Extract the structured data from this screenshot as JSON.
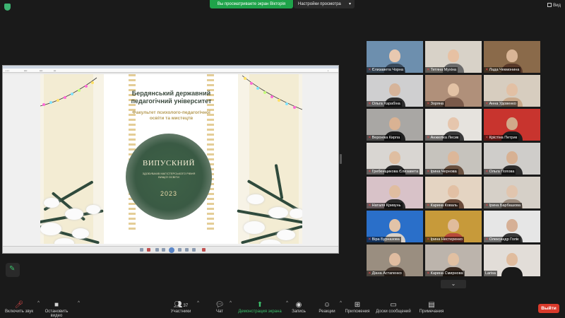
{
  "top_bar": {
    "share_notice": "Вы просматриваете экран Вікторія",
    "view_settings": "Настройки просмотра",
    "view_button": "Вид",
    "icons": {
      "security": "shield-icon",
      "view": "grid-icon"
    }
  },
  "slide": {
    "university": [
      "Бердянський державний",
      "педагогічний університет"
    ],
    "faculty": [
      "Факультет психолого-педагогічної",
      "освіти та мистецтв"
    ],
    "main_title": "ВИПУСКНИЙ",
    "subtitle": [
      "ЗДОБУВАЧІВ МАГІСТЕРСЬКОГО РІВНЯ",
      "ВИЩОЇ ОСВІТИ"
    ],
    "year": "2023",
    "colors": {
      "green": "#3e6247",
      "gold": "#b59a53",
      "cream": "#f7f3e6"
    }
  },
  "participants": [
    {
      "name": "Єлизавета Чорна",
      "muted": true
    },
    {
      "name": "Тетяна Мухіна",
      "muted": true
    },
    {
      "name": "Лада Чекмонина",
      "muted": true
    },
    {
      "name": "Ольга Харабіна",
      "muted": true,
      "active": true
    },
    {
      "name": "Зоряна",
      "muted": true
    },
    {
      "name": "Анна Удовенко",
      "muted": true
    },
    {
      "name": "Вероніка Кирпа",
      "muted": true
    },
    {
      "name": "Анжеліка Лесик",
      "muted": true
    },
    {
      "name": "Крістіна Петрик",
      "muted": true
    },
    {
      "name": "Гребенщикова Єлизавета",
      "muted": true
    },
    {
      "name": "Ірина Чернова",
      "muted": true
    },
    {
      "name": "Ольга Попова",
      "muted": true
    },
    {
      "name": "Наталя Кривунь",
      "muted": true
    },
    {
      "name": "Карина Коваль",
      "muted": true
    },
    {
      "name": "Ірина Барбашова",
      "muted": true
    },
    {
      "name": "Віра Бурназова",
      "muted": true
    },
    {
      "name": "Ірина Нестеренко",
      "muted": true
    },
    {
      "name": "Олександр Голік",
      "muted": true
    },
    {
      "name": "Діана Астапенко",
      "muted": true
    },
    {
      "name": "Карина Смирнова",
      "muted": true
    },
    {
      "name": "Larisa",
      "muted": false
    }
  ],
  "toolbar": {
    "mic": {
      "label": "Включить звук",
      "icon": "mic-off-icon"
    },
    "video": {
      "label": "Остановить видео",
      "icon": "video-icon"
    },
    "participants": {
      "label": "Участники",
      "count": "37",
      "icon": "users-icon"
    },
    "chat": {
      "label": "Чат",
      "icon": "chat-icon"
    },
    "share": {
      "label": "Демонстрация экрана",
      "icon": "share-screen-icon"
    },
    "record": {
      "label": "Запись",
      "icon": "record-icon"
    },
    "reactions": {
      "label": "Реакции",
      "icon": "reaction-icon"
    },
    "apps": {
      "label": "Приложения",
      "icon": "apps-icon"
    },
    "whiteboard": {
      "label": "Доски сообщений",
      "icon": "whiteboard-icon"
    },
    "notes": {
      "label": "Примечания",
      "icon": "notes-icon"
    },
    "exit": "Выйти"
  },
  "colors": {
    "accent_green": "#1fa34a",
    "exit_red": "#d93a2b",
    "active_tile": "#c7e86a"
  }
}
